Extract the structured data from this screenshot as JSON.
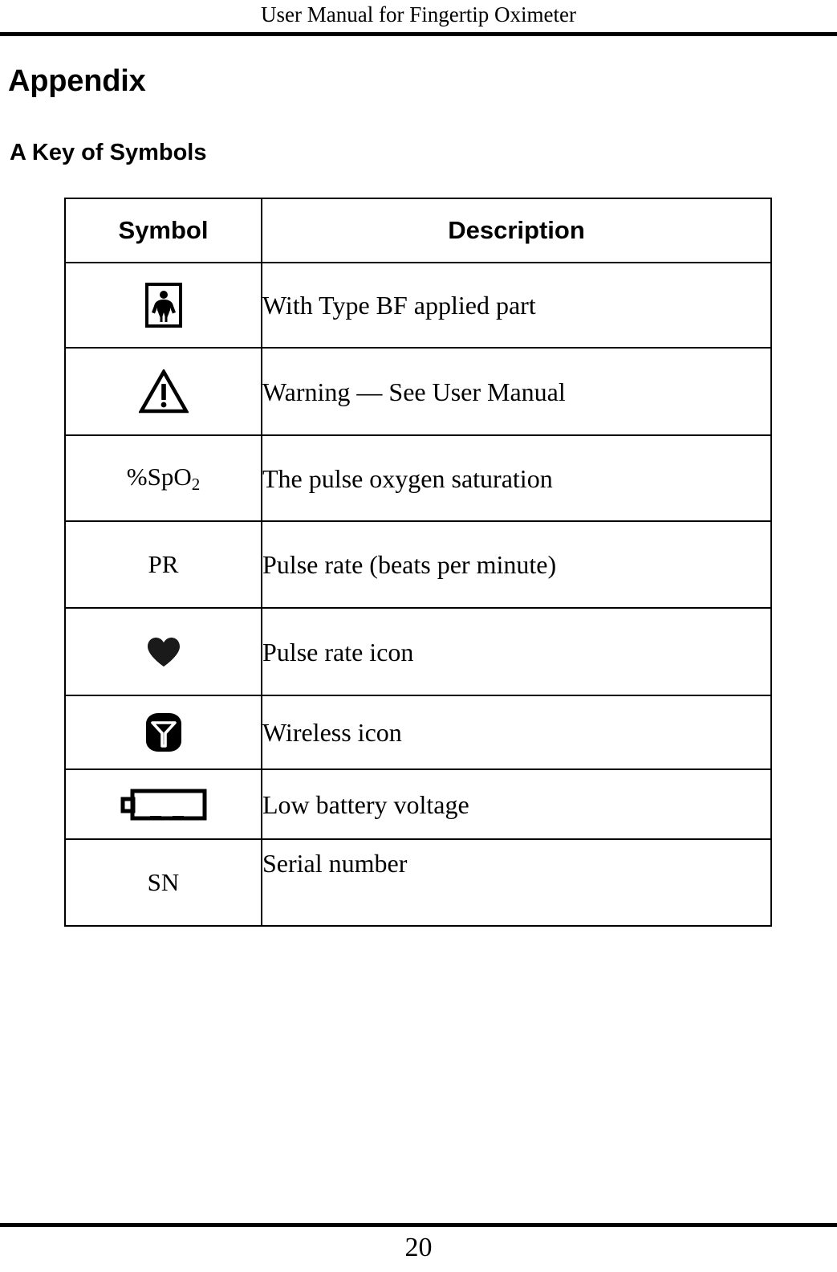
{
  "header": {
    "running_title": "User Manual for Fingertip Oximeter"
  },
  "headings": {
    "appendix": "Appendix",
    "section": "A Key of Symbols"
  },
  "table": {
    "columns": [
      "Symbol",
      "Description"
    ],
    "rows": [
      {
        "symbol_icon": "type-bf-applied-part-icon",
        "symbol_text": "",
        "description": "With Type BF applied part"
      },
      {
        "symbol_icon": "warning-triangle-icon",
        "symbol_text": "",
        "description": "Warning — See User Manual"
      },
      {
        "symbol_icon": "",
        "symbol_text": "%SpO2",
        "symbol_text_base": "%SpO",
        "symbol_text_sub": "2",
        "description": "The pulse oxygen saturation"
      },
      {
        "symbol_icon": "",
        "symbol_text": "PR",
        "description": "Pulse rate (beats per minute)"
      },
      {
        "symbol_icon": "heart-icon",
        "symbol_text": "",
        "description": "Pulse rate icon"
      },
      {
        "symbol_icon": "wireless-icon",
        "symbol_text": "",
        "description": "Wireless icon"
      },
      {
        "symbol_icon": "low-battery-icon",
        "symbol_text": "",
        "description": "Low battery voltage"
      },
      {
        "symbol_icon": "",
        "symbol_text": "SN",
        "description": "Serial number"
      }
    ]
  },
  "footer": {
    "page_number": "20"
  },
  "colors": {
    "ink": "#000000",
    "paper": "#ffffff"
  }
}
